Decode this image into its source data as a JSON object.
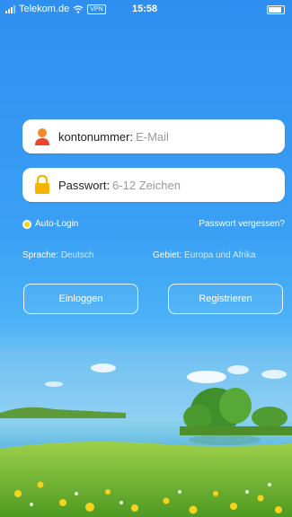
{
  "status_bar": {
    "carrier": "Telekom.de",
    "vpn": "VPN",
    "time": "15:58"
  },
  "login": {
    "username_label": "kontonummer:",
    "username_placeholder": "E-Mail",
    "password_label": "Passwort:",
    "password_placeholder": "6-12 Zeichen",
    "auto_login": "Auto-Login",
    "forgot_password": "Passwort vergessen?",
    "language_key": "Sprache:",
    "language_value": "Deutsch",
    "region_key": "Gebiet:",
    "region_value": "Europa und Afrika",
    "login_button": "Einloggen",
    "register_button": "Registrieren"
  },
  "icons": {
    "user": "user-icon",
    "lock": "lock-icon",
    "wifi": "wifi-icon",
    "battery": "battery-icon",
    "signal": "signal-icon"
  },
  "colors": {
    "background": "#3aa0f5",
    "user_icon_head": "#f08a2a",
    "user_icon_body": "#e8452e",
    "lock_icon": "#f4b400",
    "auto_login_dot": "#f5d800",
    "value_text": "#c8ecff"
  }
}
